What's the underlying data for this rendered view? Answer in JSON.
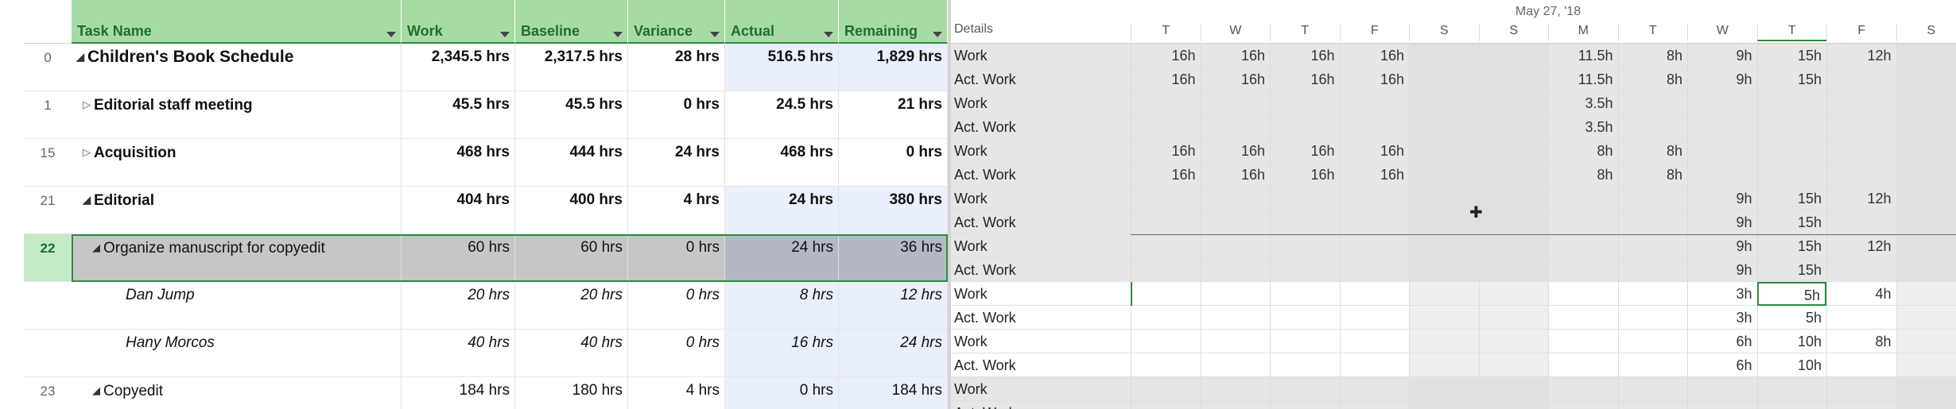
{
  "columns": {
    "task_name": "Task Name",
    "work": "Work",
    "baseline": "Baseline",
    "variance": "Variance",
    "actual": "Actual",
    "remaining": "Remaining"
  },
  "tasks": [
    {
      "id": "0",
      "name": "Children's Book Schedule",
      "work": "2,345.5 hrs",
      "baseline": "2,317.5 hrs",
      "variance": "28 hrs",
      "actual": "516.5 hrs",
      "remaining": "1,829 hrs",
      "level": 0,
      "expander": "collapse",
      "style": "bold"
    },
    {
      "id": "1",
      "name": "Editorial staff meeting",
      "work": "45.5 hrs",
      "baseline": "45.5 hrs",
      "variance": "0 hrs",
      "actual": "24.5 hrs",
      "remaining": "21 hrs",
      "level": 1,
      "expander": "expand",
      "style": "bold"
    },
    {
      "id": "15",
      "name": "Acquisition",
      "work": "468 hrs",
      "baseline": "444 hrs",
      "variance": "24 hrs",
      "actual": "468 hrs",
      "remaining": "0 hrs",
      "level": 1,
      "expander": "expand",
      "style": "bold"
    },
    {
      "id": "21",
      "name": "Editorial",
      "work": "404 hrs",
      "baseline": "400 hrs",
      "variance": "4 hrs",
      "actual": "24 hrs",
      "remaining": "380 hrs",
      "level": 1,
      "expander": "collapse",
      "style": "bold"
    },
    {
      "id": "22",
      "name": "Organize manuscript for copyedit",
      "work": "60 hrs",
      "baseline": "60 hrs",
      "variance": "0 hrs",
      "actual": "24 hrs",
      "remaining": "36 hrs",
      "level": 2,
      "expander": "collapse",
      "style": "normal",
      "selected": true
    },
    {
      "id": "",
      "name": "Dan Jump",
      "work": "20 hrs",
      "baseline": "20 hrs",
      "variance": "0 hrs",
      "actual": "8 hrs",
      "remaining": "12 hrs",
      "level": 3,
      "expander": "none",
      "style": "italic"
    },
    {
      "id": "",
      "name": "Hany Morcos",
      "work": "40 hrs",
      "baseline": "40 hrs",
      "variance": "0 hrs",
      "actual": "16 hrs",
      "remaining": "24 hrs",
      "level": 3,
      "expander": "none",
      "style": "italic"
    },
    {
      "id": "23",
      "name": "Copyedit",
      "work": "184 hrs",
      "baseline": "180 hrs",
      "variance": "4 hrs",
      "actual": "0 hrs",
      "remaining": "184 hrs",
      "level": 2,
      "expander": "collapse",
      "style": "normal"
    }
  ],
  "usage": {
    "details_header": "Details",
    "week_label": "May 27, '18",
    "days": [
      "T",
      "W",
      "T",
      "F",
      "S",
      "S",
      "M",
      "T",
      "W",
      "T",
      "F",
      "S"
    ],
    "detail_work": "Work",
    "detail_actual": "Act. Work",
    "rows": [
      {
        "label": "Work",
        "values": [
          "16h",
          "16h",
          "16h",
          "16h",
          "",
          "",
          "11.5h",
          "8h",
          "9h",
          "15h",
          "12h",
          ""
        ]
      },
      {
        "label": "Act. Work",
        "values": [
          "16h",
          "16h",
          "16h",
          "16h",
          "",
          "",
          "11.5h",
          "8h",
          "9h",
          "15h",
          "",
          ""
        ]
      },
      {
        "label": "Work",
        "values": [
          "",
          "",
          "",
          "",
          "",
          "",
          "3.5h",
          "",
          "",
          "",
          "",
          ""
        ]
      },
      {
        "label": "Act. Work",
        "values": [
          "",
          "",
          "",
          "",
          "",
          "",
          "3.5h",
          "",
          "",
          "",
          "",
          ""
        ]
      },
      {
        "label": "Work",
        "values": [
          "16h",
          "16h",
          "16h",
          "16h",
          "",
          "",
          "8h",
          "8h",
          "",
          "",
          "",
          ""
        ]
      },
      {
        "label": "Act. Work",
        "values": [
          "16h",
          "16h",
          "16h",
          "16h",
          "",
          "",
          "8h",
          "8h",
          "",
          "",
          "",
          ""
        ]
      },
      {
        "label": "Work",
        "values": [
          "",
          "",
          "",
          "",
          "",
          "",
          "",
          "",
          "9h",
          "15h",
          "12h",
          ""
        ]
      },
      {
        "label": "Act. Work",
        "values": [
          "",
          "",
          "",
          "",
          "",
          "",
          "",
          "",
          "9h",
          "15h",
          "",
          ""
        ]
      },
      {
        "label": "Work",
        "values": [
          "",
          "",
          "",
          "",
          "",
          "",
          "",
          "",
          "9h",
          "15h",
          "12h",
          ""
        ]
      },
      {
        "label": "Act. Work",
        "values": [
          "",
          "",
          "",
          "",
          "",
          "",
          "",
          "",
          "9h",
          "15h",
          "",
          ""
        ]
      },
      {
        "label": "Work",
        "values": [
          "",
          "",
          "",
          "",
          "",
          "",
          "",
          "",
          "3h",
          "5h",
          "4h",
          ""
        ]
      },
      {
        "label": "Act. Work",
        "values": [
          "",
          "",
          "",
          "",
          "",
          "",
          "",
          "",
          "3h",
          "5h",
          "",
          ""
        ]
      },
      {
        "label": "Work",
        "values": [
          "",
          "",
          "",
          "",
          "",
          "",
          "",
          "",
          "6h",
          "10h",
          "8h",
          ""
        ]
      },
      {
        "label": "Act. Work",
        "values": [
          "",
          "",
          "",
          "",
          "",
          "",
          "",
          "",
          "6h",
          "10h",
          "",
          ""
        ]
      },
      {
        "label": "Work",
        "values": [
          "",
          "",
          "",
          "",
          "",
          "",
          "",
          "",
          "",
          "",
          "",
          ""
        ]
      },
      {
        "label": "Act. Work",
        "values": [
          "",
          "",
          "",
          "",
          "",
          "",
          "",
          "",
          "",
          "",
          "",
          ""
        ]
      }
    ]
  },
  "colors": {
    "header_green": "#a6dba6",
    "header_text": "#1f6f2f",
    "selected_row": "#c6c6c6",
    "actual_highlight": "#eaf0fb",
    "summary_shade": "#e6e6e6",
    "weekend_shade": "#efefef"
  }
}
